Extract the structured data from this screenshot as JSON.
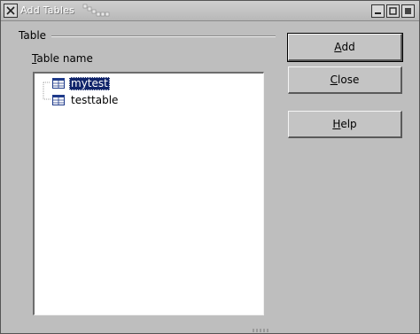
{
  "window": {
    "title": "Add Tables"
  },
  "group": {
    "label": "Table"
  },
  "table_list": {
    "label_mnemonic": "T",
    "label_rest": "able name",
    "items": [
      {
        "label": "mytest",
        "selected": true
      },
      {
        "label": "testtable",
        "selected": false
      }
    ]
  },
  "buttons": {
    "add": {
      "mnemonic": "A",
      "rest": "dd"
    },
    "close": {
      "mnemonic": "C",
      "rest": "lose"
    },
    "help": {
      "mnemonic": "H",
      "rest": "elp"
    }
  },
  "colors": {
    "selection_bg": "#10246a",
    "dialog_bg": "#bebebe"
  }
}
